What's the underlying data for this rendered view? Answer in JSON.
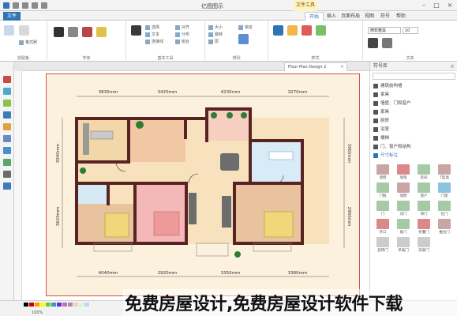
{
  "window": {
    "title": "亿图图示",
    "context_tab": "文件工具"
  },
  "ribbon_tabs": [
    "文件",
    "开始",
    "插入",
    "页面布局",
    "视图",
    "符号",
    "帮助"
  ],
  "ribbon_groups": [
    "剪贴板",
    "字体",
    "基本工具",
    "排列",
    "样式",
    "文本"
  ],
  "ribbon_small_labels": [
    "格式刷",
    "选择",
    "文本",
    "连接线",
    "对齐",
    "分布",
    "组合",
    "大小",
    "旋转",
    "层",
    "锁定"
  ],
  "font": {
    "name": "微软雅黑",
    "size": "10"
  },
  "doc_tab": "Floor Plan Design 2",
  "panel": {
    "title": "符号库",
    "categories": [
      "建筑结构墙",
      "家具",
      "墙壁、门和窗户",
      "家具",
      "厨房",
      "浴室",
      "楼梯",
      "门、窗户和结构",
      "尺寸标注"
    ],
    "shapes": [
      "墙壁",
      "墙角",
      "房间",
      "T型墙",
      "门框",
      "墙壁",
      "窗户",
      "门窗",
      "门",
      "双门",
      "滑门",
      "拉门",
      "开口",
      "角门",
      "折叠门",
      "推拉门",
      "旋转门",
      "单扇门",
      "双扇门"
    ]
  },
  "floorplan": {
    "dims_top": [
      "3830mm",
      "3420mm",
      "4230mm",
      "3270mm"
    ],
    "dims_bottom": [
      "4040mm",
      "2920mm",
      "3350mm",
      "3380mm"
    ],
    "dims_left": [
      "3940mm",
      "3620mm"
    ],
    "dims_right": [
      "3960mm",
      "2960mm"
    ]
  },
  "status": {
    "zoom": "100%"
  },
  "colors": {
    "accent": "#2f74b5",
    "wall": "#5a2323",
    "page_border": "#d64f4f",
    "floor": "#f7e2bd"
  },
  "watermark": "免费房屋设计,免费房屋设计软件下载"
}
